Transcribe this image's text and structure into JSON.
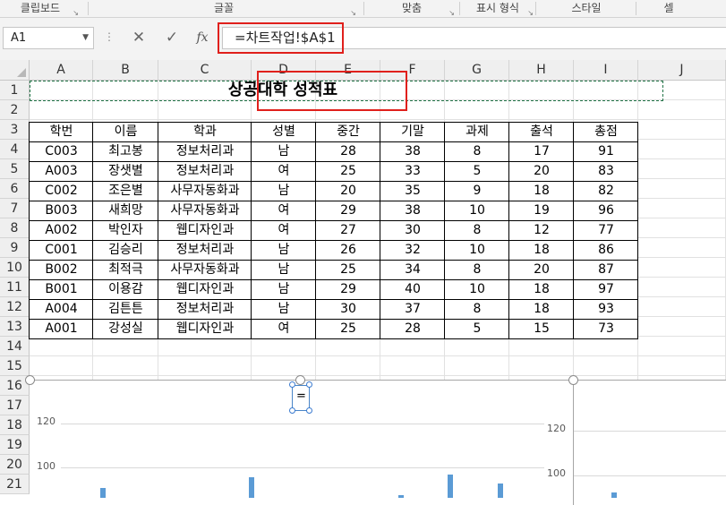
{
  "ribbon": {
    "groups": [
      {
        "label": "클립보드",
        "launcher": "↘"
      },
      {
        "label": "글꼴",
        "launcher": "↘"
      },
      {
        "label": "맞춤",
        "launcher": "↘"
      },
      {
        "label": "표시 형식",
        "launcher": "↘"
      },
      {
        "label": "스타일",
        "launcher": ""
      },
      {
        "label": "셀",
        "launcher": ""
      }
    ]
  },
  "formula_bar": {
    "name_box": "A1",
    "name_dropdown_icon": "chevron-down-icon",
    "cancel_icon": "✕",
    "enter_icon": "✓",
    "function_icon": "fx",
    "formula": "=차트작업!$A$1"
  },
  "columns": [
    "A",
    "B",
    "C",
    "D",
    "E",
    "F",
    "G",
    "H",
    "I",
    "J"
  ],
  "rows": [
    "1",
    "2",
    "3",
    "4",
    "5",
    "6",
    "7",
    "8",
    "9",
    "10",
    "11",
    "12",
    "13",
    "14",
    "15",
    "16",
    "17",
    "18",
    "19",
    "20",
    "21"
  ],
  "sheet": {
    "title": "상공대학 성적표",
    "headers": [
      "학번",
      "이름",
      "학과",
      "성별",
      "중간",
      "기말",
      "과제",
      "출석",
      "총점"
    ],
    "records": [
      [
        "C003",
        "최고봉",
        "정보처리과",
        "남",
        "28",
        "38",
        "8",
        "17",
        "91"
      ],
      [
        "A003",
        "장샛별",
        "정보처리과",
        "여",
        "25",
        "33",
        "5",
        "20",
        "83"
      ],
      [
        "C002",
        "조은별",
        "사무자동화과",
        "남",
        "20",
        "35",
        "9",
        "18",
        "82"
      ],
      [
        "B003",
        "새희망",
        "사무자동화과",
        "여",
        "29",
        "38",
        "10",
        "19",
        "96"
      ],
      [
        "A002",
        "박인자",
        "웹디자인과",
        "여",
        "27",
        "30",
        "8",
        "12",
        "77"
      ],
      [
        "C001",
        "김승리",
        "정보처리과",
        "남",
        "26",
        "32",
        "10",
        "18",
        "86"
      ],
      [
        "B002",
        "최적극",
        "사무자동화과",
        "남",
        "25",
        "34",
        "8",
        "20",
        "87"
      ],
      [
        "B001",
        "이용감",
        "웹디자인과",
        "남",
        "29",
        "40",
        "10",
        "18",
        "97"
      ],
      [
        "A004",
        "김튼튼",
        "정보처리과",
        "남",
        "30",
        "37",
        "8",
        "18",
        "93"
      ],
      [
        "A001",
        "강성실",
        "웹디자인과",
        "여",
        "25",
        "28",
        "5",
        "15",
        "73"
      ]
    ]
  },
  "chart": {
    "title_textbox": "=",
    "y_ticks": [
      "120",
      "100"
    ],
    "right_y_ticks": [
      "120",
      "100"
    ]
  },
  "chart_data": {
    "type": "bar",
    "y_ticks_visible": [
      100,
      120
    ],
    "visible_bars_approx": [
      91,
      96,
      97,
      93
    ]
  },
  "colors": {
    "accent_red": "#e0201c",
    "bar_blue": "#5b9bd5",
    "selection_green": "#217346"
  }
}
